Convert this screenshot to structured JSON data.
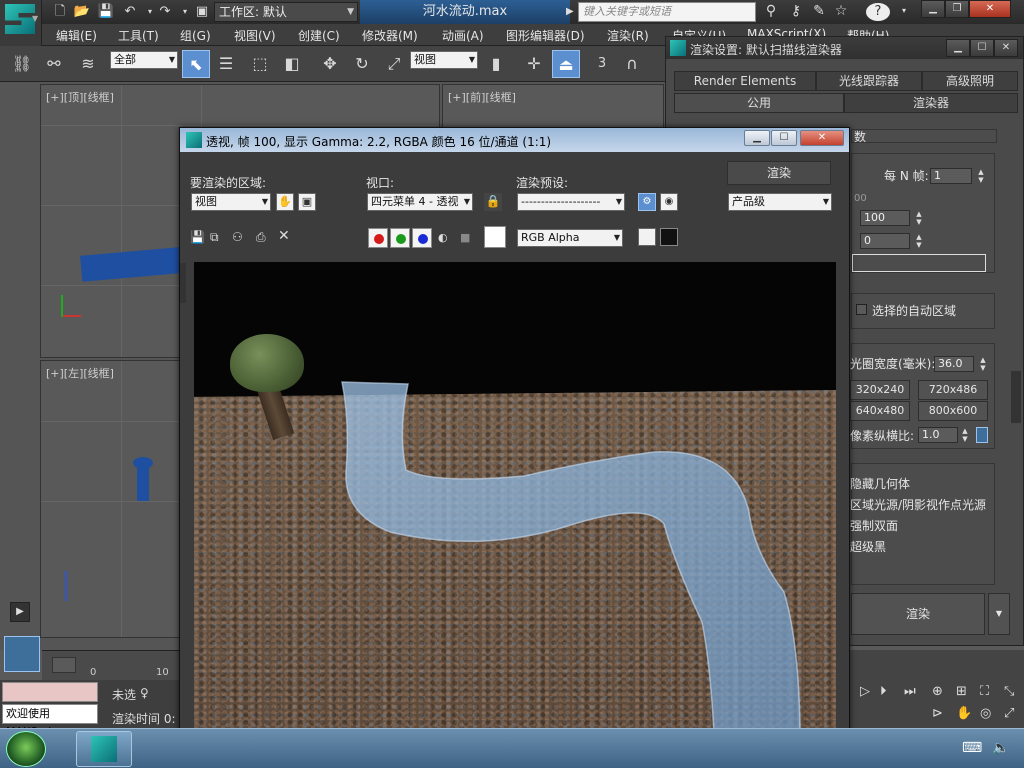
{
  "titlebar": {
    "workspace_label": "工作区: 默认",
    "document_title": "河水流动.max",
    "search_placeholder": "键入关键字或短语"
  },
  "menubar": {
    "items": [
      "编辑(E)",
      "工具(T)",
      "组(G)",
      "视图(V)",
      "创建(C)",
      "修改器(M)",
      "动画(A)",
      "图形编辑器(D)",
      "渲染(R)",
      "自定义(U)",
      "MAXScript(X)",
      "帮助(H)"
    ]
  },
  "toolbar": {
    "selection_filter": "全部",
    "reference_coord": "视图",
    "snap_label": "3"
  },
  "viewports": {
    "top_left": "[+][顶][线框]",
    "top_right": "[+][前][线框]",
    "bottom_left": "[+][左][线框]"
  },
  "render_setup": {
    "title": "渲染设置: 默认扫描线渲染器",
    "tabs_row1": [
      "Render Elements",
      "光线跟踪器",
      "高级照明"
    ],
    "tabs_row2": [
      "公用",
      "渲染器"
    ],
    "rollout_title_partial": "数",
    "every_n_frames_label": "每 N 帧:",
    "every_n_frames_value": "1",
    "range_partial": "00",
    "range_end": "100",
    "range_offset": "0",
    "auto_region_label": "选择的自动区域",
    "aperture_label": "光圈宽度(毫米):",
    "aperture_value": "36.0",
    "preset_sizes": [
      "320x240",
      "720x486",
      "640x480",
      "800x600"
    ],
    "pixel_aspect_label": "像素纵横比:",
    "pixel_aspect_value": "1.0",
    "options": [
      "隐藏几何体",
      "区域光源/阴影视作点光源",
      "强制双面",
      "超级黑"
    ],
    "render_button": "渲染"
  },
  "frame_window": {
    "title": "透视, 帧 100, 显示 Gamma: 2.2, RGBA 颜色 16 位/通道 (1:1)",
    "area_label": "要渲染的区域:",
    "area_value": "视图",
    "viewport_label": "视口:",
    "viewport_value": "四元菜单 4 - 透视",
    "preset_label": "渲染预设:",
    "preset_value": "--------------------",
    "render_button": "渲染",
    "quality_value": "产品级",
    "channel_value": "RGB Alpha"
  },
  "timeline": {
    "tick_0": "0",
    "tick_10": "10"
  },
  "statusbar": {
    "welcome_text": "欢迎使用 MAXScri",
    "status_text": "未选",
    "render_time_label": "渲染时间 0:"
  },
  "colors": {
    "accent_blue": "#5b8fd0",
    "frame_title_blue": "#c5d6ea",
    "maxscript_pink": "#e8c6c6"
  }
}
